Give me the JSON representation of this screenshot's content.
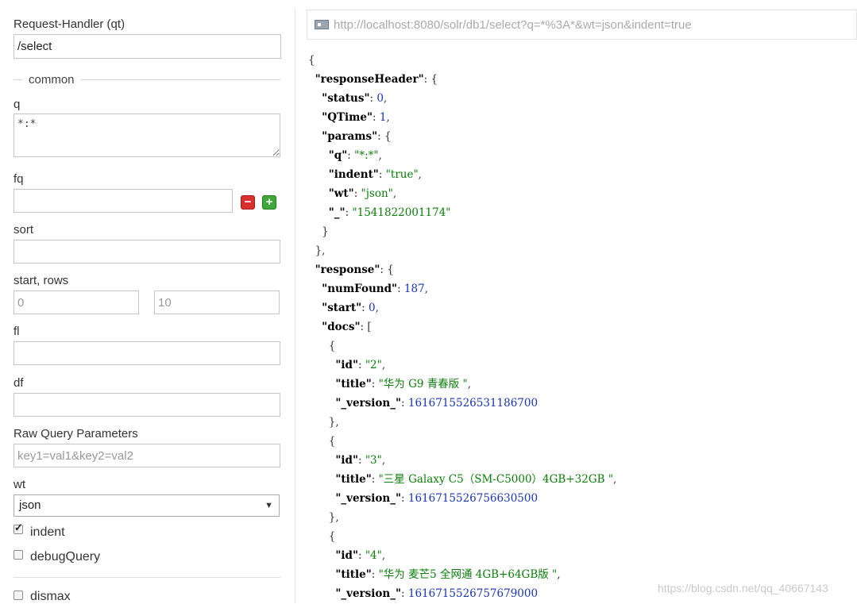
{
  "form": {
    "request_handler_label": "Request-Handler (qt)",
    "request_handler_value": "/select",
    "common_legend": "common",
    "q_label": "q",
    "q_value": "*:*",
    "fq_label": "fq",
    "fq_value": "",
    "sort_label": "sort",
    "sort_value": "",
    "start_rows_label": "start, rows",
    "start_placeholder": "0",
    "rows_placeholder": "10",
    "fl_label": "fl",
    "fl_value": "",
    "df_label": "df",
    "df_value": "",
    "raw_label": "Raw Query Parameters",
    "raw_placeholder": "key1=val1&key2=val2",
    "wt_label": "wt",
    "wt_value": "json",
    "indent_label": "indent",
    "indent_checked": true,
    "debug_label": "debugQuery",
    "debug_checked": false,
    "dismax_label": "dismax",
    "dismax_checked": false,
    "fq_remove_icon": "minus-icon",
    "fq_add_icon": "plus-icon"
  },
  "result": {
    "url": "http://localhost:8080/solr/db1/select?q=*%3A*&wt=json&indent=true",
    "lines": [
      [
        [
          "p",
          "{"
        ]
      ],
      [
        [
          "p",
          "  "
        ],
        [
          "k",
          "\"responseHeader\""
        ],
        [
          "p",
          ": {"
        ]
      ],
      [
        [
          "p",
          "    "
        ],
        [
          "k",
          "\"status\""
        ],
        [
          "p",
          ": "
        ],
        [
          "n",
          "0"
        ],
        [
          "p",
          ","
        ]
      ],
      [
        [
          "p",
          "    "
        ],
        [
          "k",
          "\"QTime\""
        ],
        [
          "p",
          ": "
        ],
        [
          "n",
          "1"
        ],
        [
          "p",
          ","
        ]
      ],
      [
        [
          "p",
          "    "
        ],
        [
          "k",
          "\"params\""
        ],
        [
          "p",
          ": {"
        ]
      ],
      [
        [
          "p",
          "      "
        ],
        [
          "k",
          "\"q\""
        ],
        [
          "p",
          ": "
        ],
        [
          "s",
          "\"*:*\""
        ],
        [
          "p",
          ","
        ]
      ],
      [
        [
          "p",
          "      "
        ],
        [
          "k",
          "\"indent\""
        ],
        [
          "p",
          ": "
        ],
        [
          "s",
          "\"true\""
        ],
        [
          "p",
          ","
        ]
      ],
      [
        [
          "p",
          "      "
        ],
        [
          "k",
          "\"wt\""
        ],
        [
          "p",
          ": "
        ],
        [
          "s",
          "\"json\""
        ],
        [
          "p",
          ","
        ]
      ],
      [
        [
          "p",
          "      "
        ],
        [
          "k",
          "\"_\""
        ],
        [
          "p",
          ": "
        ],
        [
          "s",
          "\"1541822001174\""
        ]
      ],
      [
        [
          "p",
          "    }"
        ]
      ],
      [
        [
          "p",
          "  },"
        ]
      ],
      [
        [
          "p",
          "  "
        ],
        [
          "k",
          "\"response\""
        ],
        [
          "p",
          ": {"
        ]
      ],
      [
        [
          "p",
          "    "
        ],
        [
          "k",
          "\"numFound\""
        ],
        [
          "p",
          ": "
        ],
        [
          "n",
          "187"
        ],
        [
          "p",
          ","
        ]
      ],
      [
        [
          "p",
          "    "
        ],
        [
          "k",
          "\"start\""
        ],
        [
          "p",
          ": "
        ],
        [
          "n",
          "0"
        ],
        [
          "p",
          ","
        ]
      ],
      [
        [
          "p",
          "    "
        ],
        [
          "k",
          "\"docs\""
        ],
        [
          "p",
          ": ["
        ]
      ],
      [
        [
          "p",
          "      {"
        ]
      ],
      [
        [
          "p",
          "        "
        ],
        [
          "k",
          "\"id\""
        ],
        [
          "p",
          ": "
        ],
        [
          "s",
          "\"2\""
        ],
        [
          "p",
          ","
        ]
      ],
      [
        [
          "p",
          "        "
        ],
        [
          "k",
          "\"title\""
        ],
        [
          "p",
          ": "
        ],
        [
          "s",
          "\"华为 G9 青春版 \""
        ],
        [
          "p",
          ","
        ]
      ],
      [
        [
          "p",
          "        "
        ],
        [
          "k",
          "\"_version_\""
        ],
        [
          "p",
          ": "
        ],
        [
          "n",
          "1616715526531186700"
        ]
      ],
      [
        [
          "p",
          "      },"
        ]
      ],
      [
        [
          "p",
          "      {"
        ]
      ],
      [
        [
          "p",
          "        "
        ],
        [
          "k",
          "\"id\""
        ],
        [
          "p",
          ": "
        ],
        [
          "s",
          "\"3\""
        ],
        [
          "p",
          ","
        ]
      ],
      [
        [
          "p",
          "        "
        ],
        [
          "k",
          "\"title\""
        ],
        [
          "p",
          ": "
        ],
        [
          "s",
          "\"三星 Galaxy C5（SM-C5000）4GB+32GB \""
        ],
        [
          "p",
          ","
        ]
      ],
      [
        [
          "p",
          "        "
        ],
        [
          "k",
          "\"_version_\""
        ],
        [
          "p",
          ": "
        ],
        [
          "n",
          "1616715526756630500"
        ]
      ],
      [
        [
          "p",
          "      },"
        ]
      ],
      [
        [
          "p",
          "      {"
        ]
      ],
      [
        [
          "p",
          "        "
        ],
        [
          "k",
          "\"id\""
        ],
        [
          "p",
          ": "
        ],
        [
          "s",
          "\"4\""
        ],
        [
          "p",
          ","
        ]
      ],
      [
        [
          "p",
          "        "
        ],
        [
          "k",
          "\"title\""
        ],
        [
          "p",
          ": "
        ],
        [
          "s",
          "\"华为 麦芒5 全网通 4GB+64GB版 \""
        ],
        [
          "p",
          ","
        ]
      ],
      [
        [
          "p",
          "        "
        ],
        [
          "k",
          "\"_version_\""
        ],
        [
          "p",
          ": "
        ],
        [
          "n",
          "1616715526757679000"
        ]
      ]
    ]
  },
  "watermark": "https://blog.csdn.net/qq_40667143"
}
